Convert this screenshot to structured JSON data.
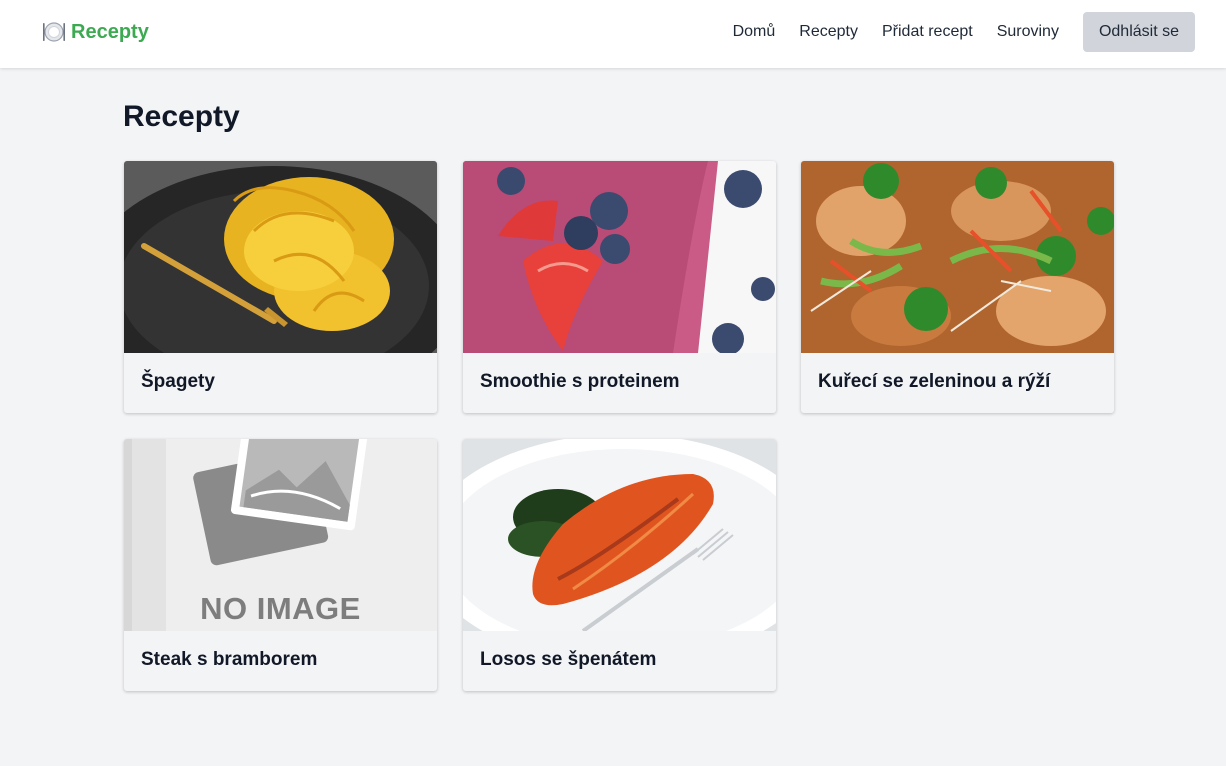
{
  "header": {
    "brand": "Recepty",
    "nav": [
      "Domů",
      "Recepty",
      "Přidat recept",
      "Suroviny"
    ],
    "logout_label": "Odhlásit se"
  },
  "page": {
    "title": "Recepty"
  },
  "recipes": [
    {
      "title": "Špagety",
      "image": "spaghetti-photo"
    },
    {
      "title": "Smoothie s proteinem",
      "image": "smoothie-photo"
    },
    {
      "title": "Kuřecí se zeleninou a rýží",
      "image": "stirfry-photo"
    },
    {
      "title": "Steak s bramborem",
      "image": "no-image-placeholder",
      "placeholder_text": "NO IMAGE"
    },
    {
      "title": "Losos se špenátem",
      "image": "salmon-photo"
    }
  ],
  "colors": {
    "brand": "#3daa52",
    "background": "#f3f4f6",
    "button": "#d1d5db"
  }
}
